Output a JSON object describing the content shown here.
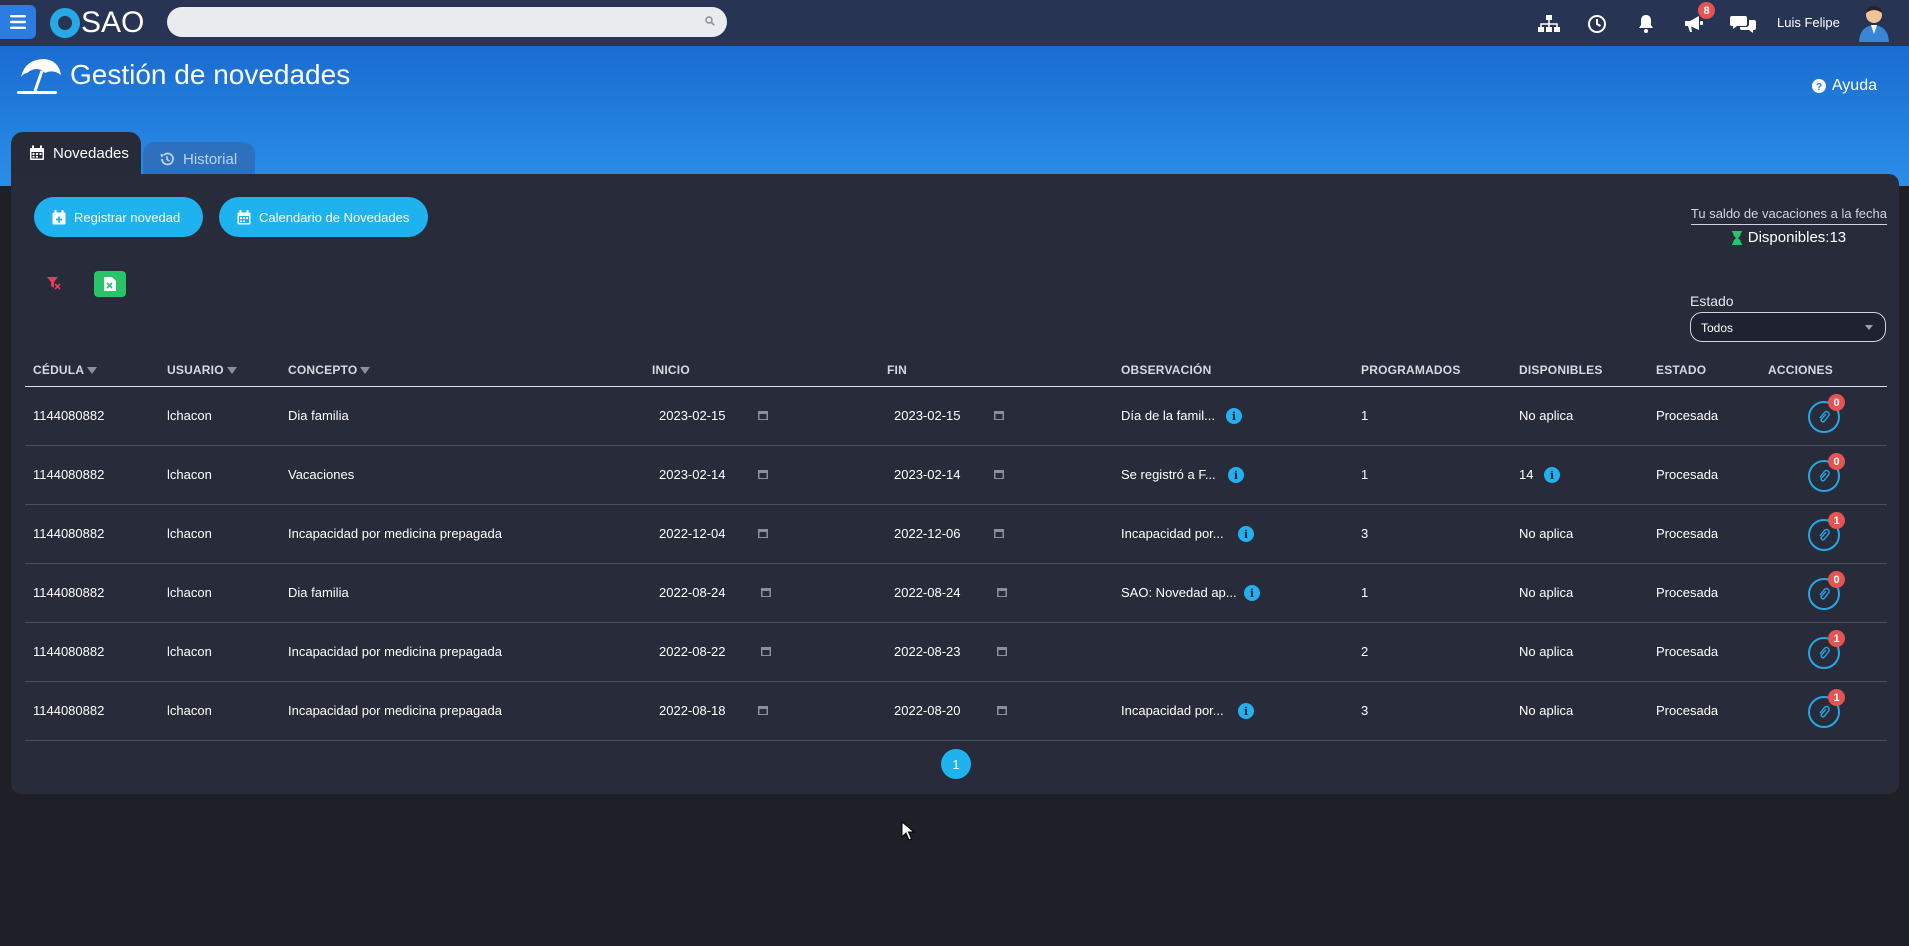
{
  "topbar": {
    "app_name": "SAO",
    "search_placeholder": "",
    "notification_badge": "8",
    "user_name": "Luis Felipe"
  },
  "header": {
    "title": "Gestión de novedades",
    "help_label": "Ayuda"
  },
  "tabs": [
    {
      "label": "Novedades",
      "active": true
    },
    {
      "label": "Historial",
      "active": false
    }
  ],
  "actions": {
    "register_label": "Registrar novedad",
    "calendar_label": "Calendario de Novedades"
  },
  "saldo": {
    "title": "Tu saldo de vacaciones a la fecha",
    "value": "Disponibles:13"
  },
  "filter": {
    "label": "Estado",
    "selected": "Todos"
  },
  "table": {
    "columns": [
      "CÉDULA",
      "USUARIO",
      "CONCEPTO",
      "INICIO",
      "FIN",
      "OBSERVACIÓN",
      "PROGRAMADOS",
      "DISPONIBLES",
      "ESTADO",
      "ACCIONES"
    ],
    "rows": [
      {
        "cedula": "1144080882",
        "usuario": "lchacon",
        "concepto": "Dia familia",
        "inicio": "2023-02-15",
        "fin": "2023-02-15",
        "observacion": "Día de la famil...",
        "programados": "1",
        "disponibles": "No aplica",
        "estado": "Procesada",
        "adjuntos": "0"
      },
      {
        "cedula": "1144080882",
        "usuario": "lchacon",
        "concepto": "Vacaciones",
        "inicio": "2023-02-14",
        "fin": "2023-02-14",
        "observacion": "Se registró a F...",
        "programados": "1",
        "disponibles": "14",
        "estado": "Procesada",
        "adjuntos": "0"
      },
      {
        "cedula": "1144080882",
        "usuario": "lchacon",
        "concepto": "Incapacidad por medicina prepagada",
        "inicio": "2022-12-04",
        "fin": "2022-12-06",
        "observacion": "Incapacidad por...",
        "programados": "3",
        "disponibles": "No aplica",
        "estado": "Procesada",
        "adjuntos": "1"
      },
      {
        "cedula": "1144080882",
        "usuario": "lchacon",
        "concepto": "Dia familia",
        "inicio": "2022-08-24",
        "fin": "2022-08-24",
        "observacion": "SAO: Novedad ap...",
        "programados": "1",
        "disponibles": "No aplica",
        "estado": "Procesada",
        "adjuntos": "0"
      },
      {
        "cedula": "1144080882",
        "usuario": "lchacon",
        "concepto": "Incapacidad por medicina prepagada",
        "inicio": "2022-08-22",
        "fin": "2022-08-23",
        "observacion": "",
        "programados": "2",
        "disponibles": "No aplica",
        "estado": "Procesada",
        "adjuntos": "1"
      },
      {
        "cedula": "1144080882",
        "usuario": "lchacon",
        "concepto": "Incapacidad por medicina prepagada",
        "inicio": "2022-08-18",
        "fin": "2022-08-20",
        "observacion": "Incapacidad por...",
        "programados": "3",
        "disponibles": "No aplica",
        "estado": "Procesada",
        "adjuntos": "1"
      }
    ]
  },
  "pagination": {
    "current_page": "1"
  },
  "colors": {
    "topbar": "#283453",
    "accent": "#1eb2ef",
    "card": "#282b39",
    "badge": "#e55353",
    "excel": "#27c46a"
  }
}
